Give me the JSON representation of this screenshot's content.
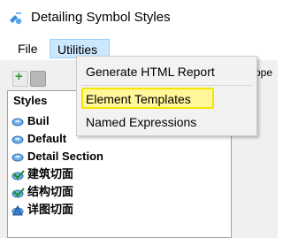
{
  "window": {
    "title": "Detailing Symbol Styles"
  },
  "menubar": {
    "items": [
      {
        "label": "File"
      },
      {
        "label": "Utilities"
      }
    ]
  },
  "utilities_menu": {
    "items": [
      {
        "label": "Generate HTML Report"
      },
      {
        "label": "Element Templates"
      },
      {
        "label": "Named Expressions"
      }
    ]
  },
  "styles_panel": {
    "header": "Styles",
    "items": [
      {
        "label": "Buil"
      },
      {
        "label": "Default"
      },
      {
        "label": "Detail Section"
      },
      {
        "label": "建筑切面"
      },
      {
        "label": "结构切面"
      },
      {
        "label": "详图切面"
      }
    ]
  },
  "properties_partial": "ope",
  "colors": {
    "highlight_fill": "#fff799",
    "highlight_border": "#f5e600",
    "menu_selected": "#cce8ff"
  }
}
